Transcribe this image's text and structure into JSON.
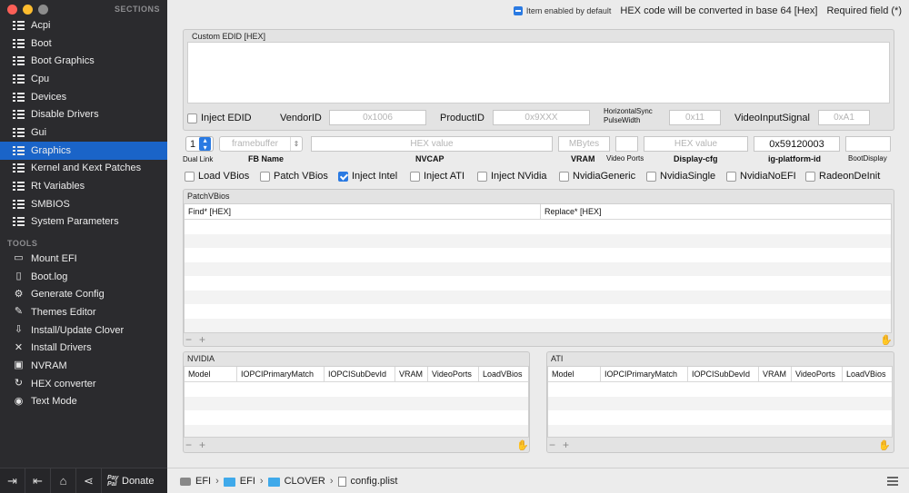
{
  "sidebar": {
    "sections_title": "SECTIONS",
    "sections": [
      {
        "label": "Acpi"
      },
      {
        "label": "Boot"
      },
      {
        "label": "Boot Graphics"
      },
      {
        "label": "Cpu"
      },
      {
        "label": "Devices"
      },
      {
        "label": "Disable Drivers"
      },
      {
        "label": "Gui"
      },
      {
        "label": "Graphics",
        "active": true
      },
      {
        "label": "Kernel and Kext Patches"
      },
      {
        "label": "Rt Variables"
      },
      {
        "label": "SMBIOS"
      },
      {
        "label": "System Parameters"
      }
    ],
    "tools_title": "TOOLS",
    "tools": [
      {
        "label": "Mount EFI",
        "icon": "drive-icon"
      },
      {
        "label": "Boot.log",
        "icon": "document-icon"
      },
      {
        "label": "Generate Config",
        "icon": "gears-icon"
      },
      {
        "label": "Themes Editor",
        "icon": "brush-icon"
      },
      {
        "label": "Install/Update Clover",
        "icon": "download-icon"
      },
      {
        "label": "Install Drivers",
        "icon": "wrench-icon"
      },
      {
        "label": "NVRAM",
        "icon": "chip-icon"
      },
      {
        "label": "HEX converter",
        "icon": "refresh-icon"
      },
      {
        "label": "Text Mode",
        "icon": "eye-icon"
      }
    ],
    "footer": {
      "donate_label": "Donate",
      "pp_top": "Pay",
      "pp_bottom": "Pal"
    }
  },
  "topbar": {
    "item_enabled": "Item enabled by default",
    "hex_note": "HEX code will be converted in base 64 [Hex]",
    "required": "Required field (*)"
  },
  "edid": {
    "panel_label": "Custom EDID [HEX]",
    "inject_edid": "Inject EDID",
    "vendor_label": "VendorID",
    "vendor_placeholder": "0x1006",
    "product_label": "ProductID",
    "product_placeholder": "0x9XXX",
    "hsync_label_1": "HorizontalSync",
    "hsync_label_2": "PulseWidth",
    "hsync_placeholder": "0x11",
    "videoinput_label": "VideoInputSignal",
    "videoinput_placeholder": "0xA1"
  },
  "fb": {
    "dual_link_value": "1",
    "dual_link_label": "Dual Link",
    "fb_name_placeholder": "framebuffer",
    "fb_name_label": "FB Name",
    "nvcap_placeholder": "HEX value",
    "nvcap_label": "NVCAP",
    "vram_placeholder": "MBytes",
    "vram_label": "VRAM",
    "video_ports_label": "Video Ports",
    "display_cfg_placeholder": "HEX value",
    "display_cfg_label": "Display-cfg",
    "ig_platform_value": "0x59120003",
    "ig_platform_label": "ig-platform-id",
    "boot_display_label": "BootDisplay"
  },
  "checks": [
    {
      "label": "Load VBios",
      "checked": false
    },
    {
      "label": "Patch VBios",
      "checked": false
    },
    {
      "label": "Inject Intel",
      "checked": true
    },
    {
      "label": "Inject ATI",
      "checked": false
    },
    {
      "label": "Inject NVidia",
      "checked": false
    },
    {
      "label": "NvidiaGeneric",
      "checked": false
    },
    {
      "label": "NvidiaSingle",
      "checked": false
    },
    {
      "label": "NvidiaNoEFI",
      "checked": false
    },
    {
      "label": "RadeonDeInit",
      "checked": false
    }
  ],
  "patchvbios": {
    "title": "PatchVBios",
    "columns": [
      "Find* [HEX]",
      "Replace* [HEX]"
    ]
  },
  "nvidia": {
    "title": "NVIDIA",
    "columns": [
      "Model",
      "IOPCIPrimaryMatch",
      "IOPCISubDevId",
      "VRAM",
      "VideoPorts",
      "LoadVBios"
    ]
  },
  "ati": {
    "title": "ATI",
    "columns": [
      "Model",
      "IOPCIPrimaryMatch",
      "IOPCISubDevId",
      "VRAM",
      "VideoPorts",
      "LoadVBios"
    ]
  },
  "pathbar": {
    "parts": [
      "EFI",
      "EFI",
      "CLOVER",
      "config.plist"
    ]
  },
  "colors": {
    "accent": "#2a7ae2",
    "sidebar_bg": "#2b2b2e",
    "active_bg": "#1a64c8"
  }
}
